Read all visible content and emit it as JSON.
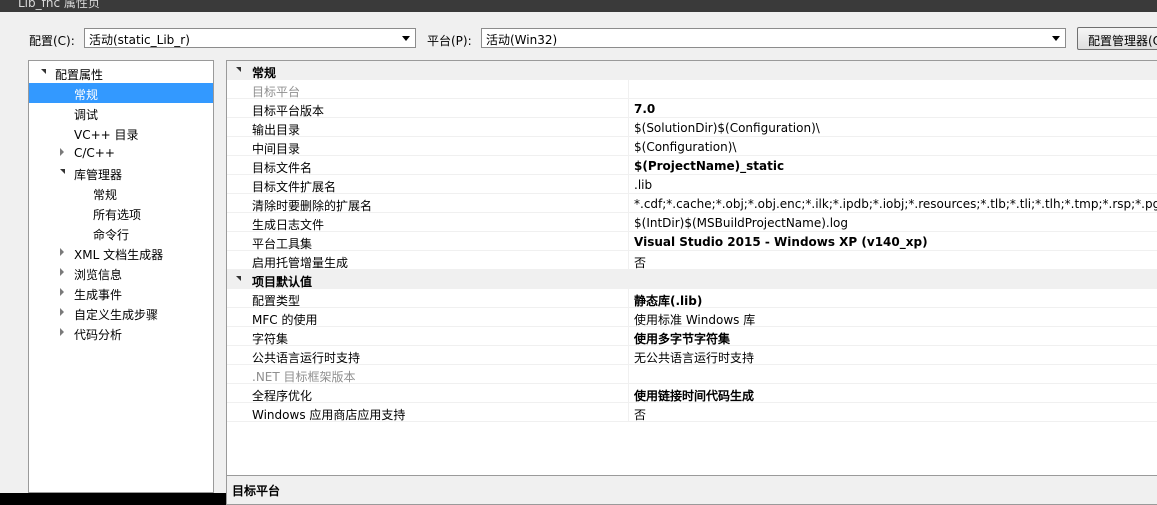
{
  "window": {
    "title": "Lib_fnc 属性页",
    "title_bg": "#3a3a3a"
  },
  "config_bar": {
    "config_label": "配置(C):",
    "config_value": "活动(static_Lib_r)",
    "platform_label": "平台(P):",
    "platform_value": "活动(Win32)",
    "config_manager_label": "配置管理器(O)..."
  },
  "tree": {
    "selected_color": "#3399ff",
    "items": [
      {
        "label": "配置属性",
        "level": 0,
        "expander": "open",
        "selected": false
      },
      {
        "label": "常规",
        "level": 1,
        "expander": "none",
        "selected": true
      },
      {
        "label": "调试",
        "level": 1,
        "expander": "none",
        "selected": false
      },
      {
        "label": "VC++ 目录",
        "level": 1,
        "expander": "none",
        "selected": false
      },
      {
        "label": "C/C++",
        "level": 1,
        "expander": "closed",
        "selected": false
      },
      {
        "label": "库管理器",
        "level": 1,
        "expander": "open",
        "selected": false
      },
      {
        "label": "常规",
        "level": 2,
        "expander": "none",
        "selected": false
      },
      {
        "label": "所有选项",
        "level": 2,
        "expander": "none",
        "selected": false
      },
      {
        "label": "命令行",
        "level": 2,
        "expander": "none",
        "selected": false
      },
      {
        "label": "XML 文档生成器",
        "level": 1,
        "expander": "closed",
        "selected": false
      },
      {
        "label": "浏览信息",
        "level": 1,
        "expander": "closed",
        "selected": false
      },
      {
        "label": "生成事件",
        "level": 1,
        "expander": "closed",
        "selected": false
      },
      {
        "label": "自定义生成步骤",
        "level": 1,
        "expander": "closed",
        "selected": false
      },
      {
        "label": "代码分析",
        "level": 1,
        "expander": "closed",
        "selected": false
      }
    ]
  },
  "grid": {
    "rows": [
      {
        "type": "category",
        "name": "常规"
      },
      {
        "type": "prop",
        "name": "目标平台",
        "value": "",
        "bold": false,
        "disabled": true
      },
      {
        "type": "prop",
        "name": "目标平台版本",
        "value": "7.0",
        "bold": true,
        "disabled": false
      },
      {
        "type": "prop",
        "name": "输出目录",
        "value": "$(SolutionDir)$(Configuration)\\",
        "bold": false,
        "disabled": false
      },
      {
        "type": "prop",
        "name": "中间目录",
        "value": "$(Configuration)\\",
        "bold": false,
        "disabled": false
      },
      {
        "type": "prop",
        "name": "目标文件名",
        "value": "$(ProjectName)_static",
        "bold": true,
        "disabled": false
      },
      {
        "type": "prop",
        "name": "目标文件扩展名",
        "value": ".lib",
        "bold": false,
        "disabled": false
      },
      {
        "type": "prop",
        "name": "清除时要删除的扩展名",
        "value": "*.cdf;*.cache;*.obj;*.obj.enc;*.ilk;*.ipdb;*.iobj;*.resources;*.tlb;*.tli;*.tlh;*.tmp;*.rsp;*.pgc;*.pgd;*",
        "bold": false,
        "disabled": false
      },
      {
        "type": "prop",
        "name": "生成日志文件",
        "value": "$(IntDir)$(MSBuildProjectName).log",
        "bold": false,
        "disabled": false
      },
      {
        "type": "prop",
        "name": "平台工具集",
        "value": "Visual Studio 2015 - Windows XP (v140_xp)",
        "bold": true,
        "disabled": false
      },
      {
        "type": "prop",
        "name": "启用托管增量生成",
        "value": "否",
        "bold": false,
        "disabled": false
      },
      {
        "type": "category",
        "name": "项目默认值"
      },
      {
        "type": "prop",
        "name": "配置类型",
        "value": "静态库(.lib)",
        "bold": true,
        "disabled": false
      },
      {
        "type": "prop",
        "name": "MFC 的使用",
        "value": "使用标准 Windows 库",
        "bold": false,
        "disabled": false
      },
      {
        "type": "prop",
        "name": "字符集",
        "value": "使用多字节字符集",
        "bold": true,
        "disabled": false
      },
      {
        "type": "prop",
        "name": "公共语言运行时支持",
        "value": "无公共语言运行时支持",
        "bold": false,
        "disabled": false
      },
      {
        "type": "prop",
        "name": ".NET 目标框架版本",
        "value": "",
        "bold": false,
        "disabled": true
      },
      {
        "type": "prop",
        "name": "全程序优化",
        "value": "使用链接时间代码生成",
        "bold": true,
        "disabled": false
      },
      {
        "type": "prop",
        "name": "Windows 应用商店应用支持",
        "value": "否",
        "bold": false,
        "disabled": false
      }
    ]
  },
  "description": {
    "title": "目标平台"
  }
}
